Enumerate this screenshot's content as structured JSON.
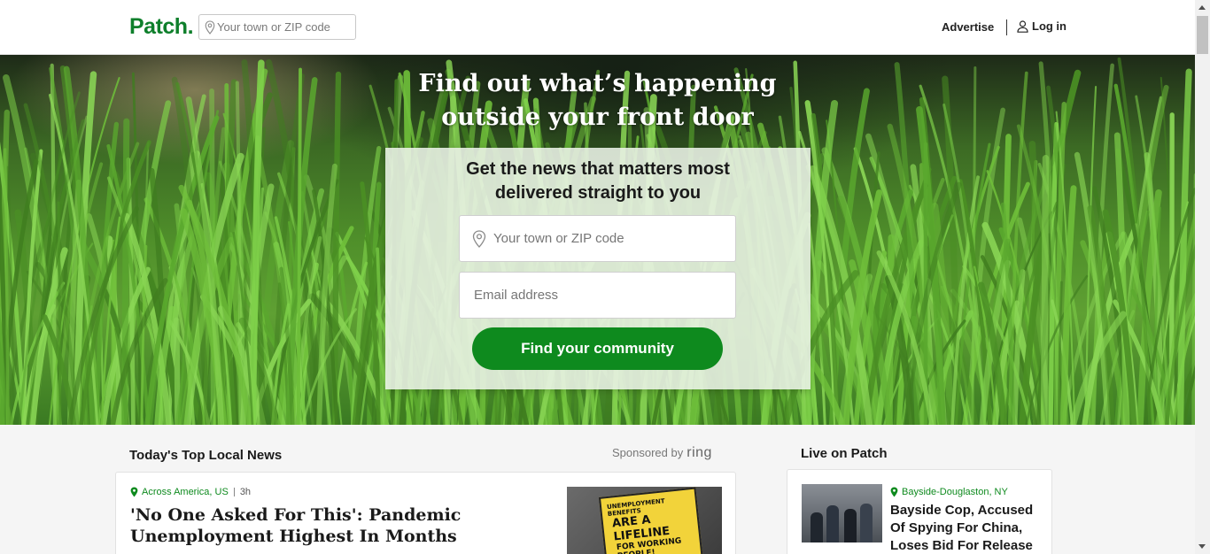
{
  "header": {
    "logo": "Patch.",
    "search_placeholder": "Your town or ZIP code",
    "advertise": "Advertise",
    "login": "Log in"
  },
  "hero": {
    "title_line1": "Find out what’s happening",
    "title_line2": "outside your front door",
    "signup_heading_line1": "Get the news that matters most",
    "signup_heading_line2": "delivered straight to you",
    "town_placeholder": "Your town or ZIP code",
    "email_placeholder": "Email address",
    "button_label": "Find your community"
  },
  "top_news": {
    "title": "Today's Top Local News",
    "sponsored_by": "Sponsored by",
    "sponsor": "ring",
    "articles": [
      {
        "location": "Across America, US",
        "time": "3h",
        "headline": "'No One Asked For This': Pandemic Unemployment Highest In Months",
        "image_sign_text": [
          "UNEMPLOYMENT BENEFITS",
          "ARE A LIFELINE",
          "FOR WORKING PEOPLE!"
        ]
      }
    ]
  },
  "live": {
    "title": "Live on Patch",
    "items": [
      {
        "location": "Bayside-Douglaston, NY",
        "headline": "Bayside Cop, Accused Of Spying For China, Loses Bid For Release"
      }
    ]
  },
  "colors": {
    "brand_green": "#0e7f2b",
    "button_green": "#0e8a1e",
    "location_green": "#0e8a1e"
  }
}
